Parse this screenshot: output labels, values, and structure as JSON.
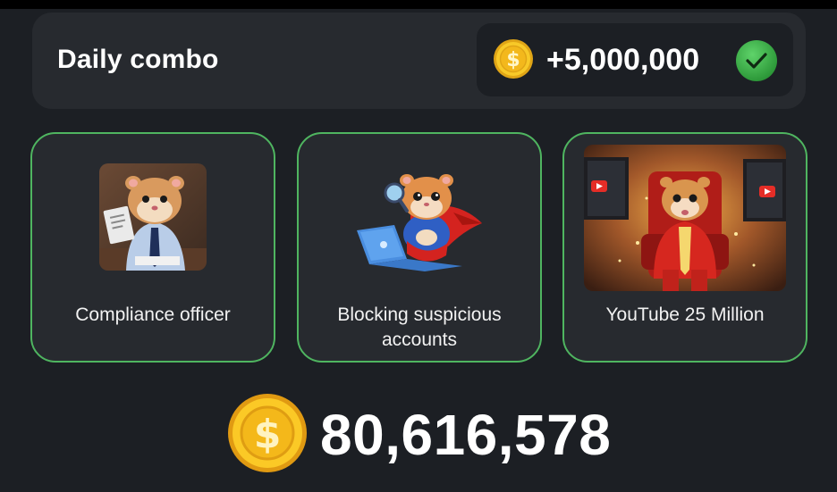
{
  "daily_combo": {
    "title": "Daily combo",
    "reward_amount": "+5,000,000",
    "completed_icon": "check-icon",
    "coin_icon": "dollar-coin-icon"
  },
  "cards": [
    {
      "label": "Compliance officer",
      "image": "hamster-compliance-officer-image"
    },
    {
      "label": "Blocking suspicious accounts",
      "image": "hamster-superhero-laptop-image"
    },
    {
      "label": "YouTube 25 Million",
      "image": "hamster-red-suit-youtube-image"
    }
  ],
  "balance": {
    "value": "80,616,578",
    "coin_icon": "dollar-coin-icon"
  },
  "colors": {
    "background": "#1c1f24",
    "panel": "#272a2f",
    "card_border": "#4fb560",
    "coin_gold": "#f3c21a",
    "check_green": "#3fb34f"
  }
}
